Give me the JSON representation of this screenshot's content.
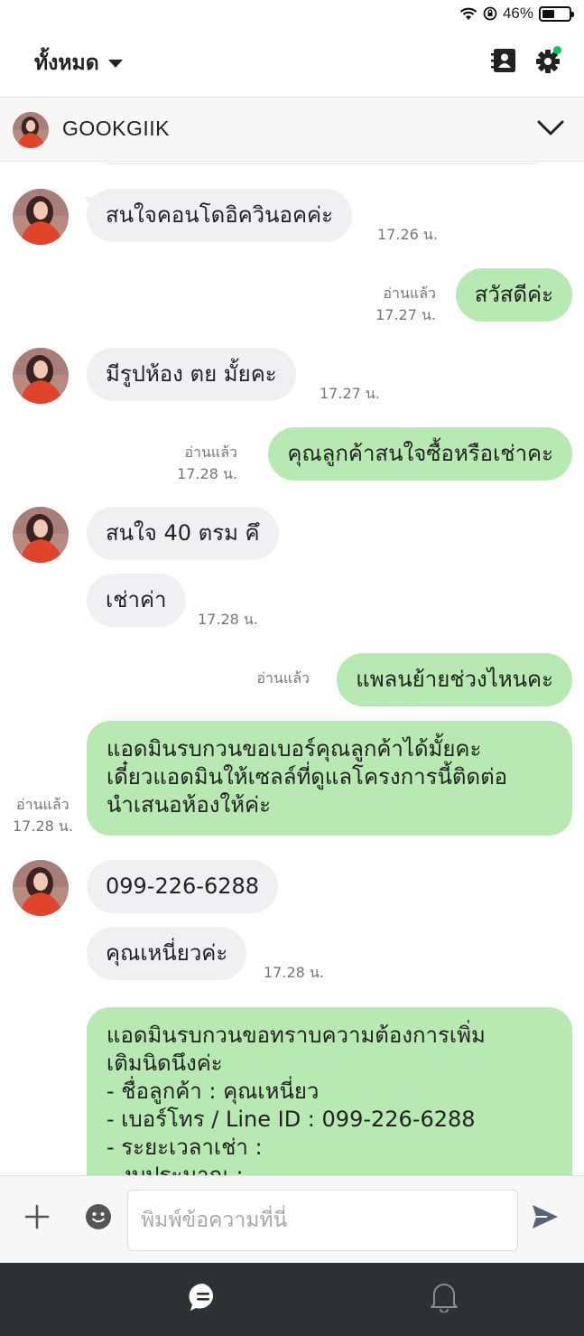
{
  "status_bar": {
    "battery_text": "46%",
    "battery_level": 0.46
  },
  "header": {
    "title": "ทั้งหมด",
    "icons": [
      "contacts-icon",
      "settings-icon"
    ]
  },
  "chat": {
    "name": "GOOKGIIK"
  },
  "messages": [
    {
      "side": "in",
      "text": "สนใจคอนโดอิควินอคค่ะ",
      "time": "17.26 น."
    },
    {
      "side": "out",
      "text": "สวัสดีค่ะ",
      "read": "อ่านแล้ว",
      "time": "17.27 น."
    },
    {
      "side": "in",
      "text": "มีรูปห้อง ตย มั้ยคะ",
      "time": "17.27 น."
    },
    {
      "side": "out",
      "text": "คุณลูกค้าสนใจซื้อหรือเช่าคะ",
      "read": "อ่านแล้ว",
      "time": "17.28 น."
    },
    {
      "side": "in",
      "text": "สนใจ 40 ตรม คึ"
    },
    {
      "side": "in",
      "text": "เช่าค่า",
      "time": "17.28 น."
    },
    {
      "side": "out",
      "text": "แพลนย้ายช่วงไหนคะ",
      "read": "อ่านแล้ว"
    },
    {
      "side": "out",
      "text": "แอดมินรบกวนขอเบอร์คุณลูกค้าได้มั้ยคะ\nเดี๋ยวแอดมินให้เซลล์ที่ดูแลโครงการนี้ติดต่อ\nนำเสนอห้องให้ค่ะ",
      "read": "อ่านแล้ว",
      "time": "17.28 น."
    },
    {
      "side": "in",
      "text": "099-226-6288"
    },
    {
      "side": "in",
      "text": "คุณเหนี่ยวค่ะ",
      "time": "17.28 น."
    },
    {
      "side": "out",
      "text": "แอดมินรบกวนขอทราบความต้องการเพิ่ม\nเติมนิดนึงค่ะ\n- ชื่อลูกค้า : คุณเหนี่ยว\n- เบอร์โทร / Line ID : 099-226-6288\n- ระยะเวลาเช่า :\n- งบประมาณ :"
    }
  ],
  "input": {
    "placeholder": "พิมพ์ข้อความที่นี่"
  },
  "bottom_nav": {
    "items": [
      "chat-icon",
      "bell-icon"
    ]
  },
  "colors": {
    "outgoing_bubble": "#b8e9b2",
    "incoming_bubble": "#f0f0f3",
    "nav_bg": "#2f3033",
    "accent_green": "#06c755"
  }
}
